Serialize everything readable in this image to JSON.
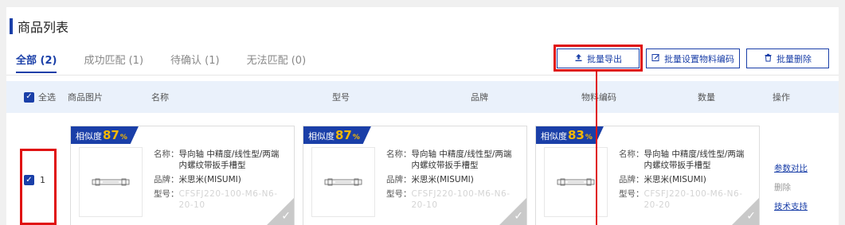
{
  "page_title": "商品列表",
  "tabs": [
    {
      "label": "全部 (2)",
      "active": true
    },
    {
      "label": "成功匹配 (1)",
      "active": false
    },
    {
      "label": "待确认 (1)",
      "active": false
    },
    {
      "label": "无法匹配 (0)",
      "active": false
    }
  ],
  "buttons": {
    "export": "批量导出",
    "set_code": "批量设置物料编码",
    "delete": "批量删除"
  },
  "table": {
    "select_all": "全选",
    "headers": [
      "商品图片",
      "名称",
      "型号",
      "品牌",
      "物料编码",
      "数量",
      "操作"
    ]
  },
  "row": {
    "index": "1",
    "checked": true,
    "cards": [
      {
        "badge_label": "相似度",
        "similarity": "87",
        "pct": "%",
        "name_label": "名称：",
        "name": "导向轴 中精度/线性型/两端内螺纹带扳手槽型",
        "brand_label": "品牌：",
        "brand": "米思米(MISUMI)",
        "model_label": "型号：",
        "model": "CFSFJ220-100-M6-N6-20-10"
      },
      {
        "badge_label": "相似度",
        "similarity": "87",
        "pct": "%",
        "name_label": "名称：",
        "name": "导向轴 中精度/线性型/两端内螺纹带扳手槽型",
        "brand_label": "品牌：",
        "brand": "米思米(MISUMI)",
        "model_label": "型号：",
        "model": "CFSFJ220-100-M6-N6-20-10"
      },
      {
        "badge_label": "相似度",
        "similarity": "83",
        "pct": "%",
        "name_label": "名称：",
        "name": "导向轴 中精度/线性型/两端内螺纹带扳手槽型",
        "brand_label": "品牌：",
        "brand": "米思米(MISUMI)",
        "model_label": "型号：",
        "model": "CFSFJ220-100-M6-N6-20-20"
      }
    ],
    "ops": {
      "compare": "参数对比",
      "delete": "删除",
      "support": "技术支持"
    }
  },
  "colors": {
    "accent": "#1a3fa8",
    "highlight": "#e01010",
    "similarity_number": "#f5b800",
    "header_bg": "#eaf1fb"
  }
}
